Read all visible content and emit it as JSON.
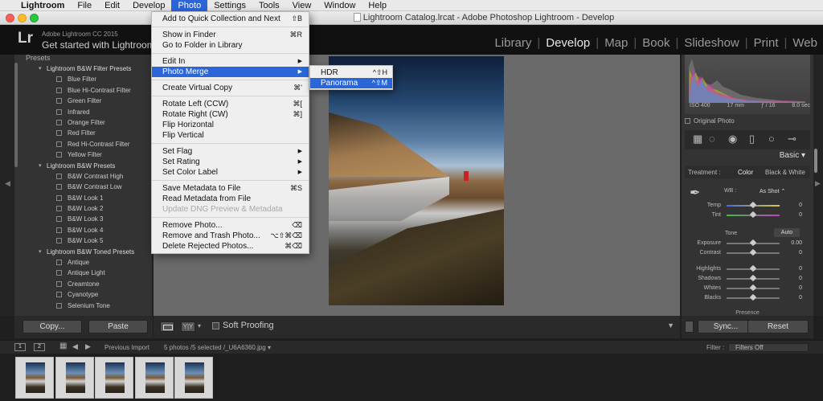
{
  "menubar": {
    "app": "Lightroom",
    "items": [
      "File",
      "Edit",
      "Develop",
      "Photo",
      "Settings",
      "Tools",
      "View",
      "Window",
      "Help"
    ],
    "active": "Photo"
  },
  "window": {
    "title": "Lightroom Catalog.lrcat - Adobe Photoshop Lightroom - Develop"
  },
  "identity": {
    "logo": "Lr",
    "version": "Adobe Lightroom CC 2015",
    "tagline": "Get started with Lightroom"
  },
  "modules": [
    "Library",
    "Develop",
    "Map",
    "Book",
    "Slideshow",
    "Print",
    "Web"
  ],
  "modules_selected": "Develop",
  "presets": {
    "header": "Presets",
    "groups": [
      {
        "name": "Lightroom B&W Filter Presets",
        "items": [
          "Blue Filter",
          "Blue Hi-Contrast Filter",
          "Green Filter",
          "Infrared",
          "Orange Filter",
          "Red Filter",
          "Red Hi-Contrast Filter",
          "Yellow Filter"
        ]
      },
      {
        "name": "Lightroom B&W Presets",
        "items": [
          "B&W Contrast High",
          "B&W Contrast Low",
          "B&W Look 1",
          "B&W Look 2",
          "B&W Look 3",
          "B&W Look 4",
          "B&W Look 5"
        ]
      },
      {
        "name": "Lightroom B&W Toned Presets",
        "items": [
          "Antique",
          "Antique Light",
          "Creamtone",
          "Cyanotype",
          "Selenium Tone"
        ]
      }
    ]
  },
  "left_buttons": {
    "copy": "Copy...",
    "paste": "Paste"
  },
  "toolbar": {
    "yy": "Y|Y",
    "soft_proofing": "Soft Proofing"
  },
  "photo_menu": {
    "items": [
      {
        "label": "Add to Quick Collection and Next",
        "shortcut": "⇧B"
      },
      {
        "sep": true
      },
      {
        "label": "Show in Finder",
        "shortcut": "⌘R"
      },
      {
        "label": "Go to Folder in Library",
        "shortcut": ""
      },
      {
        "sep": true
      },
      {
        "label": "Edit In",
        "shortcut": "▶"
      },
      {
        "label": "Photo Merge",
        "shortcut": "▶",
        "selected": true
      },
      {
        "sep": true
      },
      {
        "label": "Create Virtual Copy",
        "shortcut": "⌘'"
      },
      {
        "sep": true
      },
      {
        "label": "Rotate Left (CCW)",
        "shortcut": "⌘["
      },
      {
        "label": "Rotate Right (CW)",
        "shortcut": "⌘]"
      },
      {
        "label": "Flip Horizontal",
        "shortcut": ""
      },
      {
        "label": "Flip Vertical",
        "shortcut": ""
      },
      {
        "sep": true
      },
      {
        "label": "Set Flag",
        "shortcut": "▶"
      },
      {
        "label": "Set Rating",
        "shortcut": "▶"
      },
      {
        "label": "Set Color Label",
        "shortcut": "▶"
      },
      {
        "sep": true
      },
      {
        "label": "Save Metadata to File",
        "shortcut": "⌘S"
      },
      {
        "label": "Read Metadata from File",
        "shortcut": ""
      },
      {
        "label": "Update DNG Preview & Metadata",
        "shortcut": "",
        "disabled": true
      },
      {
        "sep": true
      },
      {
        "label": "Remove Photo...",
        "shortcut": "⌫"
      },
      {
        "label": "Remove and Trash Photo...",
        "shortcut": "⌥⇧⌘⌫"
      },
      {
        "label": "Delete Rejected Photos...",
        "shortcut": "⌘⌫"
      }
    ]
  },
  "photo_merge_menu": {
    "items": [
      {
        "label": "HDR",
        "shortcut": "^⇧H"
      },
      {
        "label": "Panorama",
        "shortcut": "^⇧M",
        "selected": true
      }
    ]
  },
  "histogram": {
    "iso": "ISO 400",
    "focal": "17 mm",
    "aperture": "ƒ / 16",
    "shutter": "8.0 sec",
    "original_photo": "Original Photo"
  },
  "basic": {
    "title": "Basic",
    "treatment_label": "Treatment :",
    "treatment_color": "Color",
    "treatment_bw": "Black & White",
    "wb_label": "WB :",
    "wb_value": "As Shot ⌃",
    "tone_label": "Tone",
    "auto": "Auto",
    "sliders": [
      {
        "label": "Temp",
        "value": "0",
        "pos": 0.5,
        "track": "temp"
      },
      {
        "label": "Tint",
        "value": "0",
        "pos": 0.5,
        "track": "tint"
      },
      {
        "label": "Exposure",
        "value": "0.00",
        "pos": 0.5,
        "track": "plain"
      },
      {
        "label": "Contrast",
        "value": "0",
        "pos": 0.5,
        "track": "plain"
      },
      {
        "label": "Highlights",
        "value": "0",
        "pos": 0.5,
        "track": "plain"
      },
      {
        "label": "Shadows",
        "value": "0",
        "pos": 0.5,
        "track": "plain"
      },
      {
        "label": "Whites",
        "value": "0",
        "pos": 0.5,
        "track": "plain"
      },
      {
        "label": "Blacks",
        "value": "0",
        "pos": 0.5,
        "track": "plain"
      }
    ],
    "presence": "Presence"
  },
  "right_buttons": {
    "sync": "Sync...",
    "reset": "Reset"
  },
  "filmstrip": {
    "monitor1": "1",
    "monitor2": "2",
    "source": "Previous Import",
    "count": "5 photos /5 selected /_U6A6360.jpg ▾",
    "filter_label": "Filter :",
    "filter_value": "Filters Off",
    "thumb_count": 5
  },
  "colors": {
    "accent": "#2b66d9",
    "panel": "#333333",
    "background": "#1f1f1f"
  }
}
